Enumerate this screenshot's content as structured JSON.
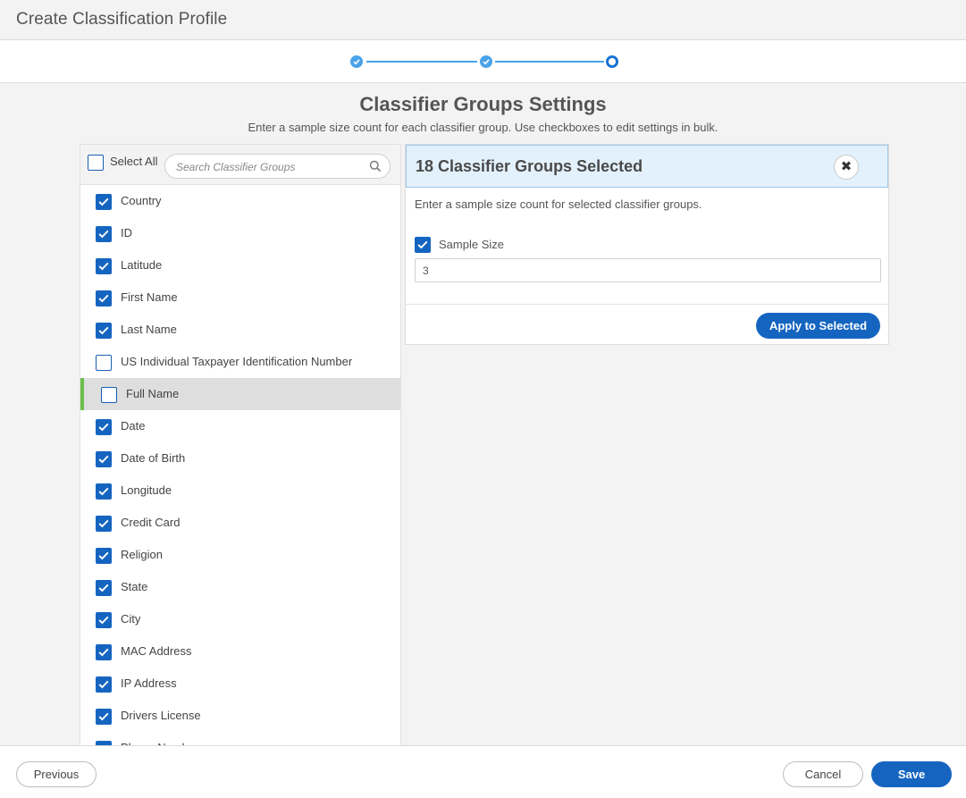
{
  "header": {
    "title": "Create Classification Profile"
  },
  "stepper": {
    "steps": [
      "complete",
      "complete",
      "current"
    ]
  },
  "page": {
    "title": "Classifier Groups Settings",
    "subtitle": "Enter a sample size count for each classifier group. Use checkboxes to edit settings in bulk."
  },
  "list_panel": {
    "select_all_label": "Select All",
    "search_placeholder": "Search Classifier Groups",
    "items": [
      {
        "label": "Country",
        "checked": true
      },
      {
        "label": "ID",
        "checked": true
      },
      {
        "label": "Latitude",
        "checked": true
      },
      {
        "label": "First Name",
        "checked": true
      },
      {
        "label": "Last Name",
        "checked": true
      },
      {
        "label": "US Individual Taxpayer Identification Number",
        "checked": false
      },
      {
        "label": "Full Name",
        "checked": false,
        "active": true
      },
      {
        "label": "Date",
        "checked": true
      },
      {
        "label": "Date of Birth",
        "checked": true
      },
      {
        "label": "Longitude",
        "checked": true
      },
      {
        "label": "Credit Card",
        "checked": true
      },
      {
        "label": "Religion",
        "checked": true
      },
      {
        "label": "State",
        "checked": true
      },
      {
        "label": "City",
        "checked": true
      },
      {
        "label": "MAC Address",
        "checked": true
      },
      {
        "label": "IP Address",
        "checked": true
      },
      {
        "label": "Drivers License",
        "checked": true
      },
      {
        "label": "Phone Number",
        "checked": true
      }
    ]
  },
  "bulk_panel": {
    "title": "18 Classifier Groups Selected",
    "description": "Enter a sample size count for selected classifier groups.",
    "sample_size_label": "Sample Size",
    "sample_size_checked": true,
    "sample_size_value": "3",
    "apply_label": "Apply to Selected"
  },
  "footer": {
    "previous_label": "Previous",
    "cancel_label": "Cancel",
    "save_label": "Save"
  },
  "colors": {
    "accent": "#1565c0",
    "step_done": "#4aa3e8",
    "active_marker": "#6abf4b"
  }
}
